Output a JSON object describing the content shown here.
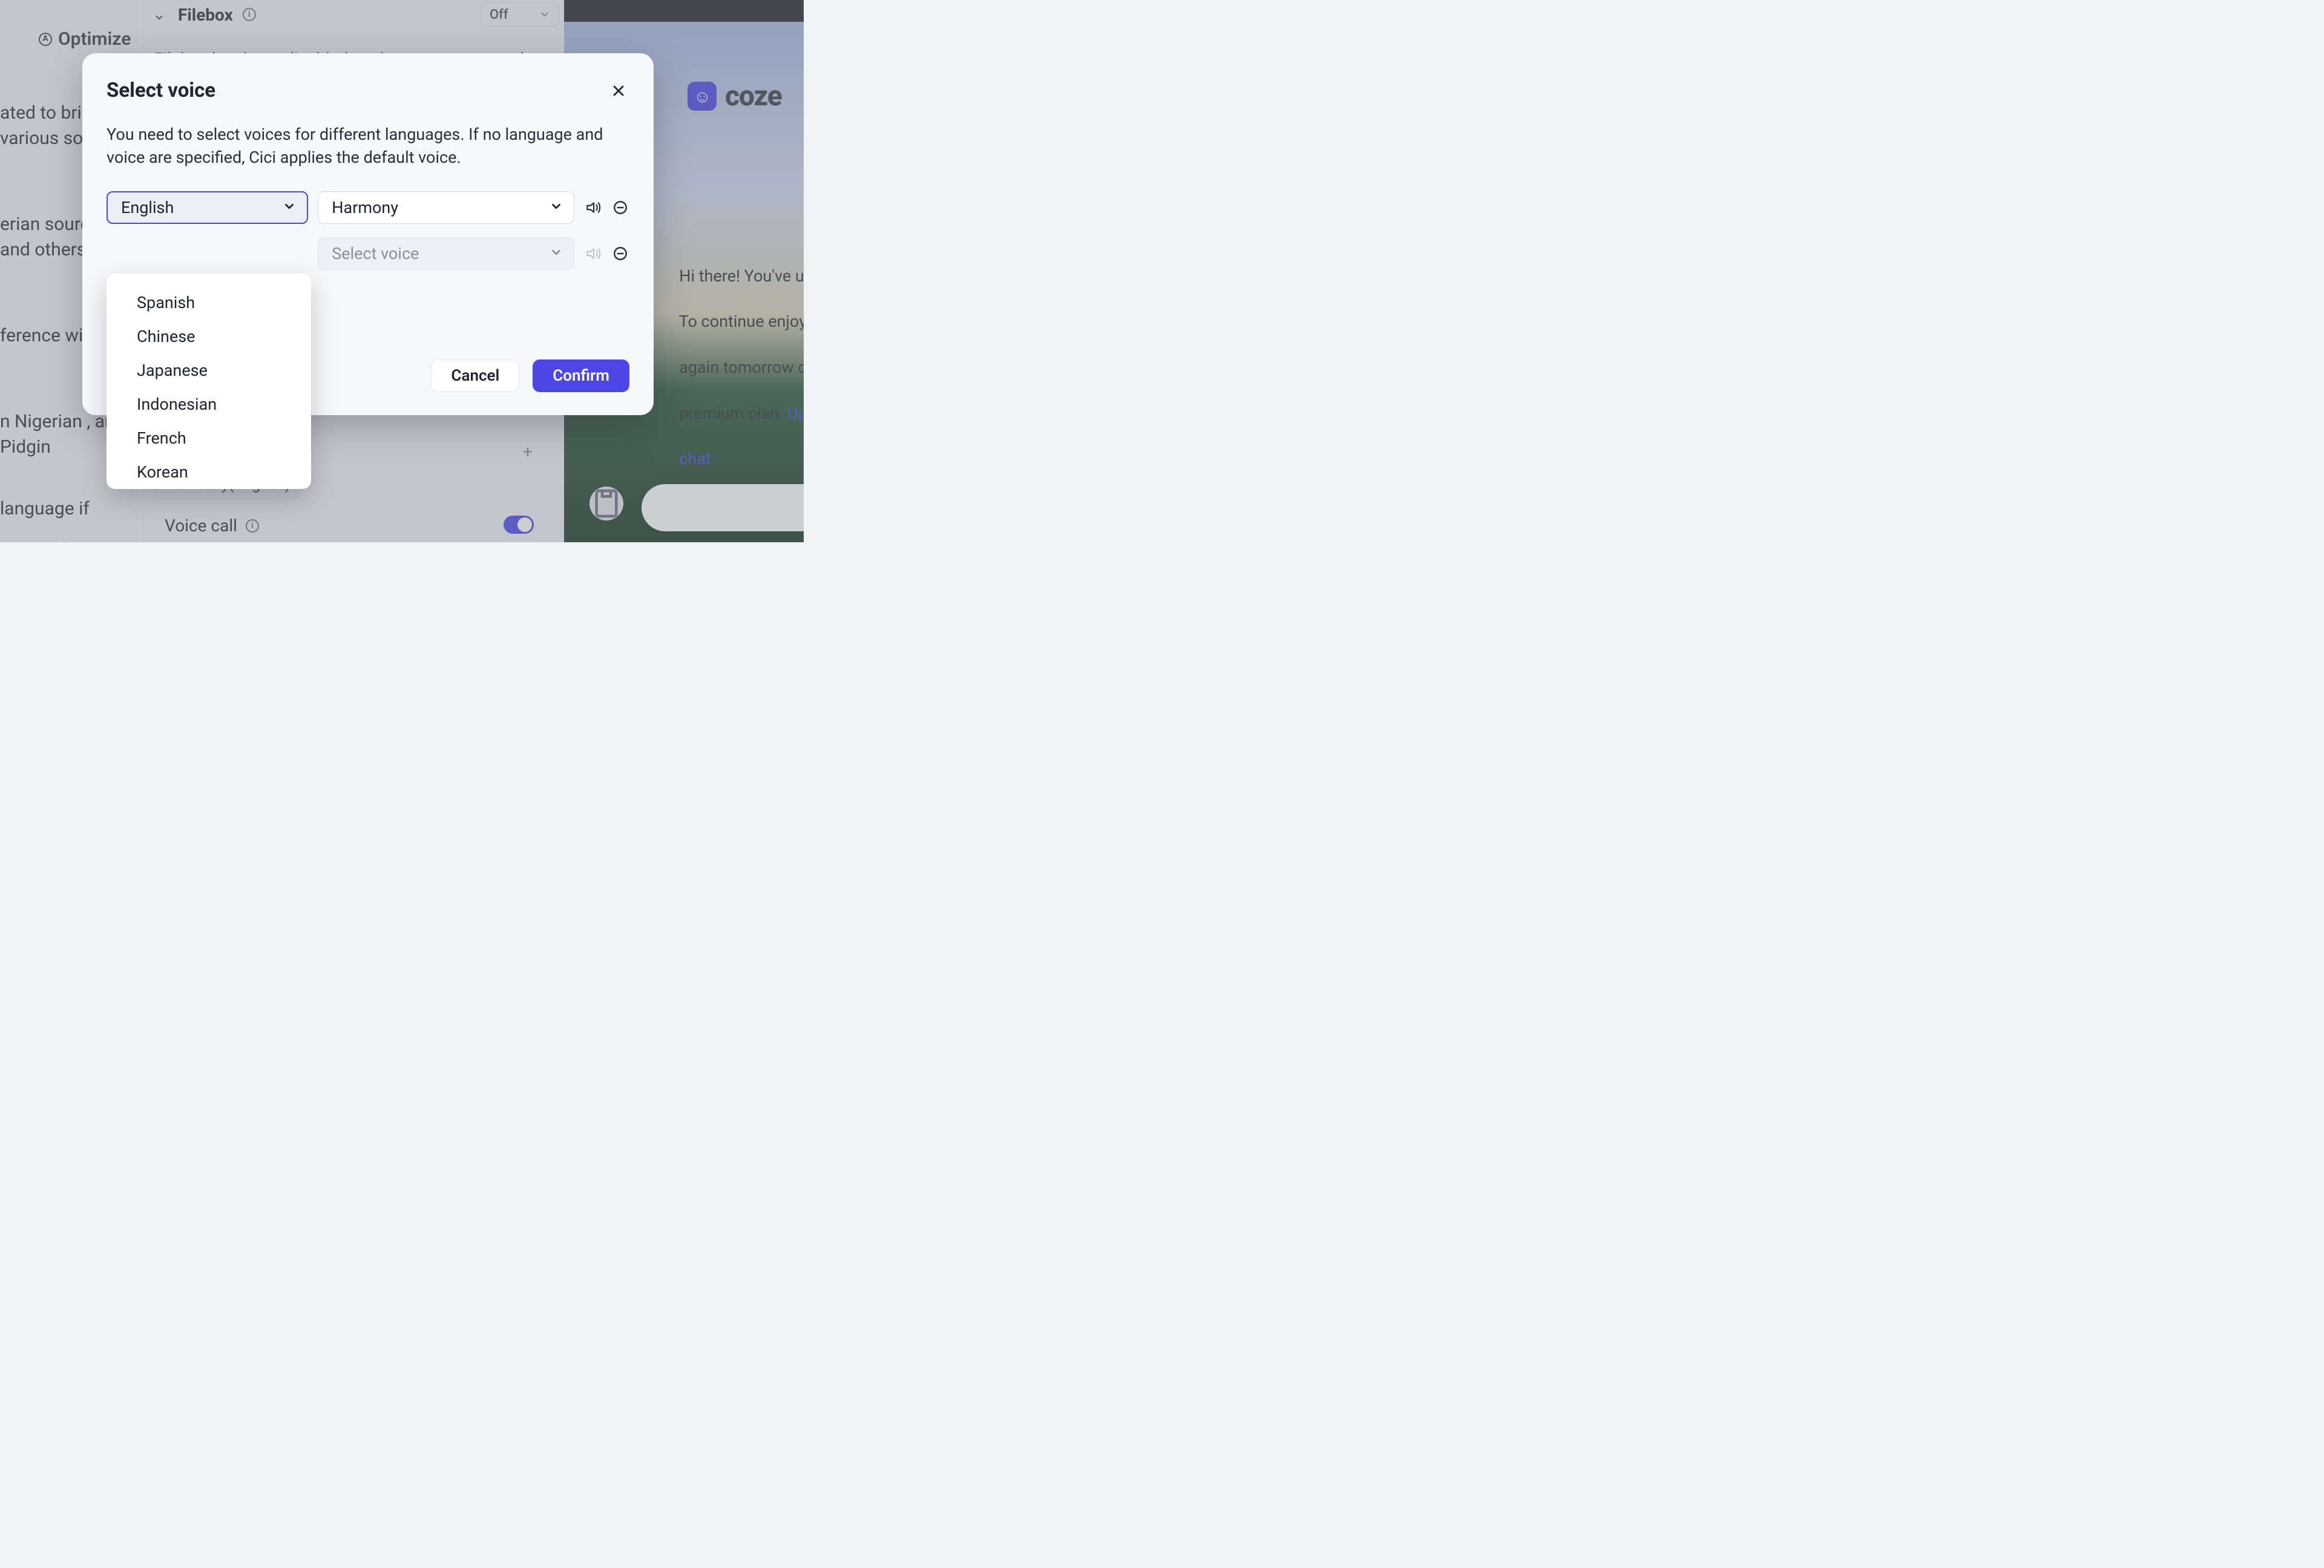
{
  "bg": {
    "sidebar": {
      "optimize_label": "Optimize",
      "aicon_letter": "A",
      "p1": "ated to bring various sourc",
      "p2": "erian sources , and others.",
      "p3": "ference with",
      "p4": "n Nigerian , and Pidgin",
      "p5": "language if",
      "p6": "ews in that"
    },
    "main": {
      "filebox_label": "Filebox",
      "info_letter": "i",
      "off_label": "Off",
      "filebox_desc": "Filebox has been disabled, and you cannot save the files. If",
      "voice_chip": "Harmony(English)",
      "voicecall_label": "Voice call",
      "plus_glyph": "+"
    },
    "right": {
      "brand": "coze",
      "msg_l1": "Hi there! You've used u",
      "msg_l2": "To continue enjoying o",
      "msg_l3": "again tomorrow or con",
      "msg_l4a": "premium plan. ",
      "msg_l4b": "Upgrade",
      "msg_l5": "chat",
      "face": "☺"
    }
  },
  "modal": {
    "title": "Select voice",
    "desc": "You need to select voices for different languages. If no language and voice are specified, Cici applies the default voice.",
    "row1": {
      "lang_label": "English",
      "voice_label": "Harmony"
    },
    "row2": {
      "voice_placeholder": "Select voice"
    },
    "cancel": "Cancel",
    "confirm": "Confirm",
    "options": {
      "o0": "",
      "o1": "Spanish",
      "o2": "Chinese",
      "o3": "Japanese",
      "o4": "Indonesian",
      "o5": "French",
      "o6": "Korean"
    }
  },
  "colors": {
    "accent": "#4b46e5"
  }
}
